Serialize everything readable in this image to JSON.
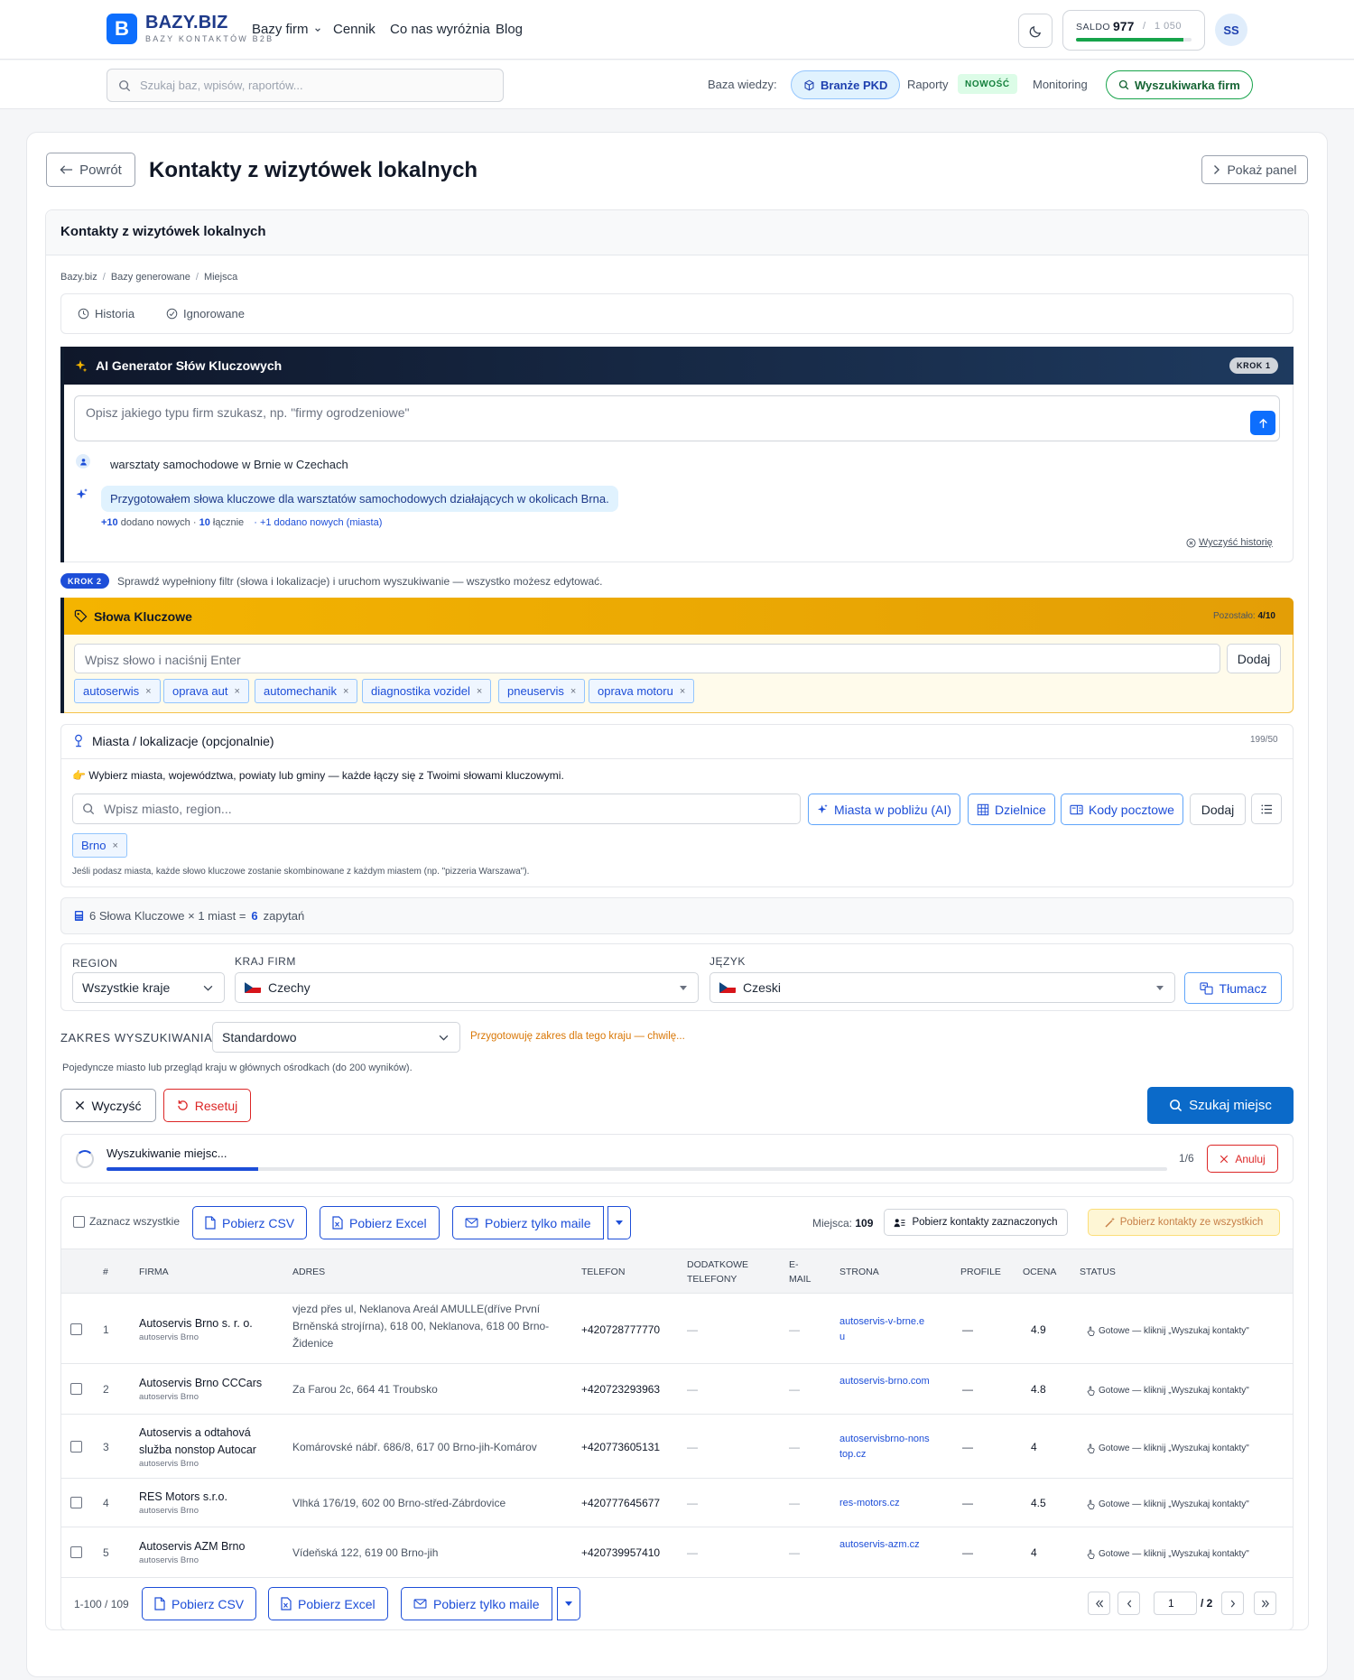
{
  "brand": {
    "logo_letter": "B",
    "name": "BAZY.BIZ",
    "tagline": "BAZY KONTAKTÓW B2B"
  },
  "nav": {
    "items": [
      "Bazy firm",
      "Cennik",
      "Co nas wyróżnia",
      "Blog"
    ]
  },
  "saldo": {
    "label": "SALDO",
    "value": "977",
    "separator": "/",
    "max": "1 050",
    "progress": 0.93
  },
  "user": {
    "initials": "SS"
  },
  "search": {
    "placeholder": "Szukaj baz, wpisów, raportów..."
  },
  "knowledge": {
    "label": "Baza wiedzy:",
    "pkd": "Branże PKD",
    "reports": "Raporty",
    "new_badge": "NOWOŚĆ",
    "monitoring": "Monitoring",
    "finder": "Wyszukiwarka firm"
  },
  "page": {
    "back": "Powrót",
    "title": "Kontakty z wizytówek lokalnych",
    "show_panel": "Pokaż panel",
    "section_title": "Kontakty z wizytówek lokalnych"
  },
  "breadcrumb": [
    "Bazy.biz",
    "Bazy generowane",
    "Miejsca"
  ],
  "breadcrumb_sep": "/",
  "history": {
    "history": "Historia",
    "ignored": "Ignorowane"
  },
  "ai": {
    "title": "AI Generator Słów Kluczowych",
    "step": "KROK 1",
    "placeholder": "Opisz jakiego typu firm szukasz, np. \"firmy ogrodzeniowe\"",
    "user_msg": "warsztaty samochodowe w Brnie w Czechach",
    "ai_msg": "Przygotowałem słowa kluczowe dla warsztatów samochodowych działających w okolicach Brna.",
    "stat_new_num": "+10",
    "stat_new": "dodano nowych",
    "stat_sep": "·",
    "stat_total_num": "10",
    "stat_total": "łącznie",
    "stat_city": "· +1 dodano nowych (miasta)",
    "clear": "Wyczyść historię"
  },
  "step2": {
    "badge": "KROK 2",
    "text": "Sprawdź wypełniony filtr (słowa i lokalizacje) i uruchom wyszukiwanie — wszystko możesz edytować."
  },
  "keywords": {
    "title": "Słowa Kluczowe",
    "remaining_label": "Pozostało:",
    "remaining": "4/10",
    "placeholder": "Wpisz słowo i naciśnij Enter",
    "add": "Dodaj",
    "remove_glyph": "×",
    "tags": [
      "autoserwis",
      "oprava aut",
      "automechanik",
      "diagnostika vozidel",
      "pneuservis",
      "oprava motoru"
    ]
  },
  "locations": {
    "title": "Miasta / lokalizacje (opcjonalnie)",
    "count": "199/50",
    "hint": "👉 Wybierz miasta, województwa, powiaty lub gminy — każde łączy się z Twoimi słowami kluczowymi.",
    "placeholder": "Wpisz miasto, region...",
    "nearby": "Miasta w pobliżu (AI)",
    "districts": "Dzielnice",
    "postal": "Kody pocztowe",
    "add": "Dodaj",
    "tags": [
      "Brno"
    ],
    "note": "Jeśli podasz miasta, każde słowo kluczowe zostanie skombinowane z każdym miastem (np. \"pizzeria Warszawa\")."
  },
  "calc": {
    "text": "6 Słowa Kluczowe × 1 miast =",
    "result": "6",
    "unit": "zapytań"
  },
  "filters": {
    "region_label": "REGION",
    "region_value": "Wszystkie kraje",
    "country_label": "KRAJ FIRM",
    "country_value": "Czechy",
    "language_label": "JĘZYK",
    "language_value": "Czeski",
    "translate": "Tłumacz"
  },
  "scope": {
    "label": "ZAKRES WYSZUKIWANIA:",
    "value": "Standardowo",
    "note": "Przygotowuję zakres dla tego kraju — chwilę...",
    "desc": "Pojedyncze miasto lub przegląd kraju w głównych ośrodkach (do 200 wyników)."
  },
  "actions": {
    "clear": "Wyczyść",
    "reset": "Resetuj",
    "search": "Szukaj miejsc"
  },
  "progress": {
    "label": "Wyszukiwanie miejsc...",
    "count": "1/6",
    "fraction": 0.143,
    "cancel": "Anuluj"
  },
  "results": {
    "select_all": "Zaznacz wszystkie",
    "csv": "Pobierz CSV",
    "excel": "Pobierz Excel",
    "emails": "Pobierz tylko maile",
    "places_label": "Miejsca:",
    "places_count": "109",
    "get_selected": "Pobierz kontakty zaznaczonych",
    "get_all": "Pobierz kontakty ze wszystkich",
    "columns": [
      "#",
      "FIRMA",
      "ADRES",
      "TELEFON",
      "DODATKOWE TELEFONY",
      "E-MAIL",
      "STRONA",
      "PROFILE",
      "OCENA",
      "STATUS"
    ],
    "rows": [
      {
        "n": "1",
        "name": "Autoservis Brno s. r. o.",
        "sub": "autoservis Brno",
        "address": "vjezd přes ul, Neklanova Areál AMULLE(dříve První Brněnská strojírna), 618 00, Neklanova, 618 00 Brno-Židenice",
        "phone": "+420728777770",
        "extra": "—",
        "email": "—",
        "site": "autoservis-v-brne.eu",
        "profile": "—",
        "rating": "4.9",
        "status": "Gotowe — kliknij „Wyszukaj kontakty\""
      },
      {
        "n": "2",
        "name": "Autoservis Brno CCCars",
        "sub": "autoservis Brno",
        "address": "Za Farou 2c, 664 41 Troubsko",
        "phone": "+420723293963",
        "extra": "—",
        "email": "—",
        "site": "autoservis-brno.com",
        "profile": "—",
        "rating": "4.8",
        "status": "Gotowe — kliknij „Wyszukaj kontakty\""
      },
      {
        "n": "3",
        "name": "Autoservis a odtahová služba nonstop Autocar",
        "sub": "autoservis Brno",
        "address": "Komárovské nábř. 686/8, 617 00 Brno-jih-Komárov",
        "phone": "+420773605131",
        "extra": "—",
        "email": "—",
        "site": "autoservisbrno-nonstop.cz",
        "profile": "—",
        "rating": "4",
        "status": "Gotowe — kliknij „Wyszukaj kontakty\""
      },
      {
        "n": "4",
        "name": "RES Motors s.r.o.",
        "sub": "autoservis Brno",
        "address": "Vlhká 176/19, 602 00 Brno-střed-Zábrdovice",
        "phone": "+420777645677",
        "extra": "—",
        "email": "—",
        "site": "res-motors.cz",
        "profile": "—",
        "rating": "4.5",
        "status": "Gotowe — kliknij „Wyszukaj kontakty\""
      },
      {
        "n": "5",
        "name": "Autoservis AZM Brno",
        "sub": "autoservis Brno",
        "address": "Vídeňská 122, 619 00 Brno-jih",
        "phone": "+420739957410",
        "extra": "—",
        "email": "—",
        "site": "autoservis-azm.cz",
        "profile": "—",
        "rating": "4",
        "status": "Gotowe — kliknij „Wyszukaj kontakty\""
      }
    ]
  },
  "pagination": {
    "range": "1-100 / 109",
    "page": "1",
    "total": "/ 2"
  },
  "colors": {
    "primary": "#0b6ac9",
    "accent_blue": "#1d4ed8",
    "keywords_header": "#f4b400",
    "success": "#16a34a",
    "danger": "#dc2626"
  }
}
